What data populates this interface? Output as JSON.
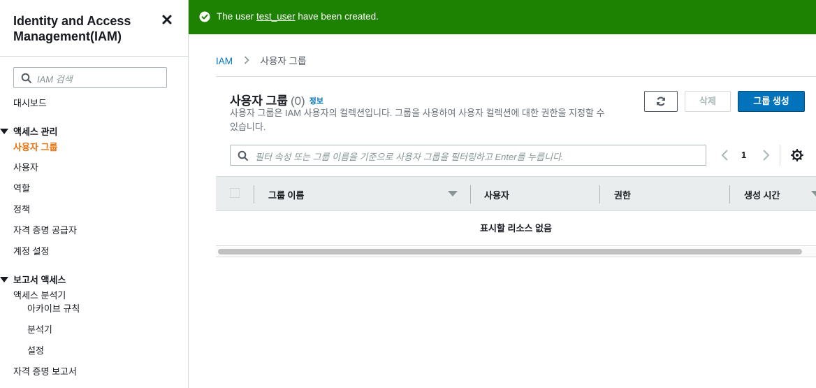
{
  "sidebar": {
    "title": "Identity and Access Management(IAM)",
    "search_placeholder": "IAM 검색",
    "dashboard": "대시보드",
    "section_access_mgmt": "액세스 관리",
    "items_access": [
      "사용자 그룹",
      "사용자",
      "역할",
      "정책",
      "자격 증명 공급자",
      "계정 설정"
    ],
    "section_reports": "보고서 액세스",
    "access_analyzer": "액세스 분석기",
    "analyzer_items": [
      "아카이브 규칙",
      "분석기",
      "설정"
    ],
    "credential_report": "자격 증명 보고서"
  },
  "flash": {
    "prefix": "The user ",
    "user_link": "test_user",
    "suffix": " have been created."
  },
  "breadcrumb": {
    "root": "IAM",
    "current": "사용자 그룹"
  },
  "panel": {
    "title": "사용자 그룹",
    "count": "(0)",
    "info": "정보",
    "description": "사용자 그룹은 IAM 사용자의 컬렉션입니다. 그룹을 사용하여 사용자 컬렉션에 대한 권한을 지정할 수 있습니다.",
    "delete_label": "삭제",
    "create_label": "그룹 생성",
    "filter_placeholder": "필터 속성 또는 그룹 이름을 기준으로 사용자 그룹을 필터링하고 Enter를 누릅니다.",
    "page": "1",
    "columns": [
      "그룹 이름",
      "사용자",
      "권한",
      "생성 시간"
    ],
    "empty_message": "표시할 리소스 없음"
  },
  "colors": {
    "success": "#1d8102",
    "primary": "#0073bb",
    "active_nav": "#ec7211"
  }
}
